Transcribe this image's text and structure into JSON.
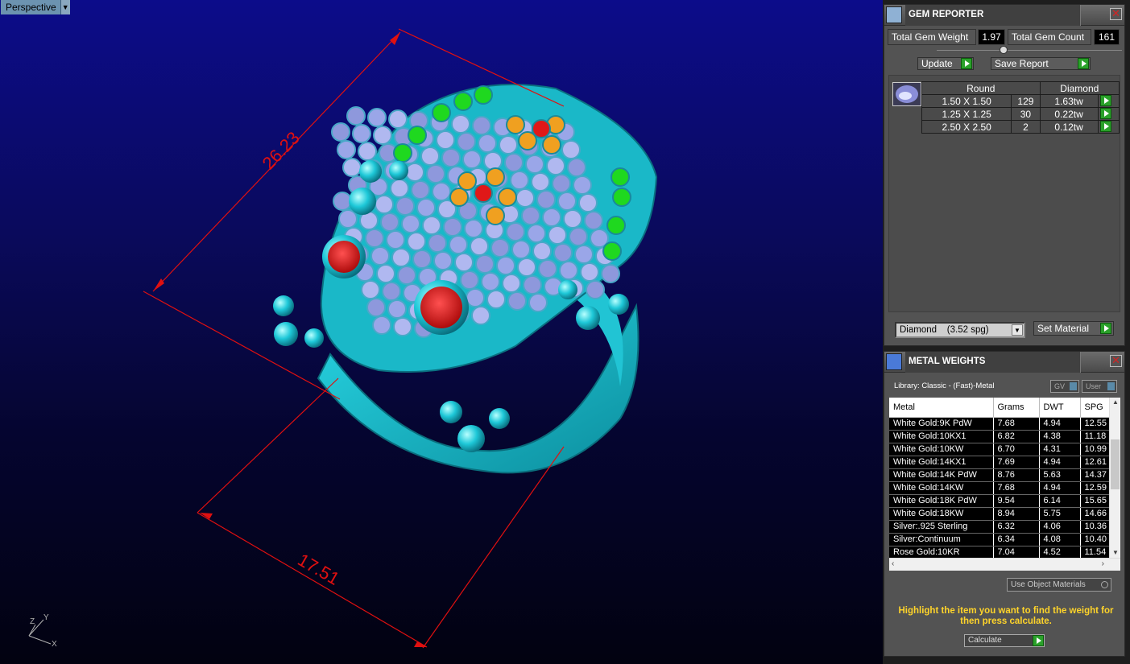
{
  "viewport": {
    "view_name": "Perspective",
    "dimension_1": "26.23",
    "dimension_2": "17.51",
    "axis_z": "Z",
    "axis_y": "Y",
    "axis_x": "X"
  },
  "gem_reporter": {
    "title": "GEM REPORTER",
    "total_weight_label": "Total Gem Weight",
    "total_weight_value": "1.97",
    "total_count_label": "Total Gem Count",
    "total_count_value": "161",
    "update_label": "Update",
    "save_report_label": "Save Report",
    "table_headers": [
      "Round",
      "Diamond"
    ],
    "rows": [
      {
        "size": "1.50 X 1.50",
        "count": "129",
        "weight": "1.63tw"
      },
      {
        "size": "1.25 X 1.25",
        "count": "30",
        "weight": "0.22tw"
      },
      {
        "size": "2.50 X 2.50",
        "count": "2",
        "weight": "0.12tw"
      }
    ],
    "material_value": "Diamond    (3.52 spg)",
    "set_material_label": "Set Material"
  },
  "metal_weights": {
    "title": "METAL WEIGHTS",
    "library": "Library: Classic - (Fast)-Metal",
    "gv_label": "GV",
    "user_label": "User",
    "columns": [
      "Metal",
      "Grams",
      "DWT",
      "SPG"
    ],
    "rows": [
      [
        "White Gold:9K PdW",
        "7.68",
        "4.94",
        "12.55"
      ],
      [
        "White Gold:10KX1",
        "6.82",
        "4.38",
        "11.18"
      ],
      [
        "White Gold:10KW",
        "6.70",
        "4.31",
        "10.99"
      ],
      [
        "White Gold:14KX1",
        "7.69",
        "4.94",
        "12.61"
      ],
      [
        "White Gold:14K PdW",
        "8.76",
        "5.63",
        "14.37"
      ],
      [
        "White Gold:14KW",
        "7.68",
        "4.94",
        "12.59"
      ],
      [
        "White Gold:18K PdW",
        "9.54",
        "6.14",
        "15.65"
      ],
      [
        "White Gold:18KW",
        "8.94",
        "5.75",
        "14.66"
      ],
      [
        "Silver:.925 Sterling",
        "6.32",
        "4.06",
        "10.36"
      ],
      [
        "Silver:Continuum",
        "6.34",
        "4.08",
        "10.40"
      ],
      [
        "Rose Gold:10KR",
        "7.04",
        "4.52",
        "11.54"
      ]
    ],
    "use_object_materials_label": "Use Object Materials",
    "hint": "Highlight the item you want to find the weight for then press calculate.",
    "calculate_label": "Calculate"
  }
}
